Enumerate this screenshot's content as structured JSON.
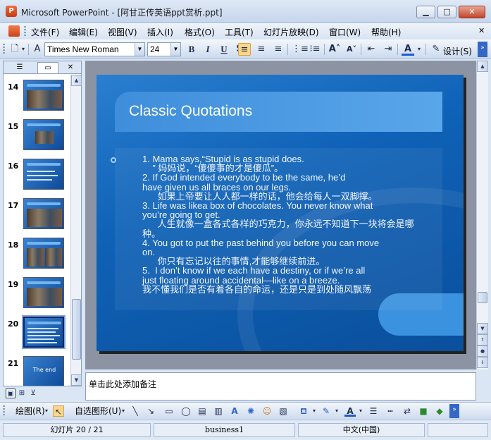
{
  "window": {
    "app_icon_text": "P",
    "title": "Microsoft PowerPoint - [阿甘正传英语ppt赏析.ppt]",
    "min_symbol": "▁",
    "max_symbol": "□",
    "close_symbol": "✕"
  },
  "menu": {
    "items": [
      "文件(F)",
      "编辑(E)",
      "视图(V)",
      "插入(I)",
      "格式(O)",
      "工具(T)",
      "幻灯片放映(D)",
      "窗口(W)",
      "帮助(H)"
    ],
    "close_doc_symbol": "✕"
  },
  "toolbar": {
    "font_name": "Times New Roman",
    "font_size": "24",
    "bold": "B",
    "italic": "I",
    "underline": "U",
    "design_label": "设计(S)"
  },
  "left_panel": {
    "tab_outline_icon": "outline-tab-icon",
    "tab_slides_icon": "slides-tab-icon",
    "close_symbol": "✕",
    "thumbnails": [
      {
        "number": "14"
      },
      {
        "number": "15"
      },
      {
        "number": "16"
      },
      {
        "number": "17"
      },
      {
        "number": "18"
      },
      {
        "number": "19"
      },
      {
        "number": "20"
      },
      {
        "number": "21",
        "text": "The end"
      }
    ],
    "selected": "20"
  },
  "slide": {
    "title": "Classic Quotations",
    "lines": [
      "1. Mama says,“Stupid is as stupid does.",
      "    ” 妈妈说，“傻傻事的才是傻瓜”。",
      "2. If God intended everybody to be the same, he’d",
      "have given us all braces on our legs.",
      "      如果上帝要让人人都一样的话，他会给每人一双脚撑。",
      "3. Life was likea box of chocolates. You never know what",
      "you’re going to get.",
      "      人生就像一盒各式各样的巧克力，你永远不知道下一块将会是哪",
      "种。",
      "4. You got to put the past behind you before you can move",
      "on.",
      "      你只有忘记以往的事情,才能够继续前进。",
      "5.  I don’t know if we each have a destiny, or if we’re all",
      "just floating around accidental—like on a breeze.",
      "我不懂我们是否有着各自的命运，还是只是到处随风飘荡"
    ]
  },
  "notes": {
    "placeholder": "单击此处添加备注"
  },
  "draw_toolbar": {
    "draw_label": "绘图(R)",
    "autoshape_label": "自选图形(U)"
  },
  "status": {
    "slide_info": "幻灯片 20 / 21",
    "design_name": "business1",
    "language": "中文(中国)"
  }
}
